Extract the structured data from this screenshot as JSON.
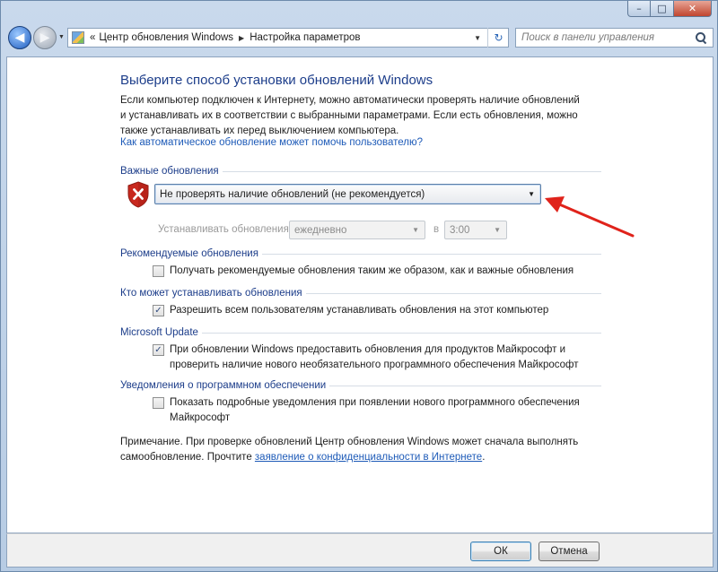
{
  "window": {
    "controls": {
      "minimize": "–",
      "maximize": "□",
      "close": "✕"
    }
  },
  "navbar": {
    "back_glyph": "◀",
    "forward_glyph": "▶",
    "breadcrumb": [
      "Центр обновления Windows",
      "Настройка параметров"
    ],
    "breadcrumb_prefix": "«",
    "search_placeholder": "Поиск в панели управления"
  },
  "page": {
    "title": "Выберите способ установки обновлений Windows",
    "intro": "Если компьютер подключен к Интернету, можно автоматически проверять наличие обновлений и устанавливать их в соответствии с выбранными параметрами. Если есть обновления, можно также устанавливать их перед выключением компьютера.",
    "help_link": "Как автоматическое обновление может помочь пользователю?"
  },
  "important": {
    "header": "Важные обновления",
    "selected": "Не проверять наличие обновлений (не рекомендуется)",
    "install_label": "Устанавливать обновления:",
    "day_value": "ежедневно",
    "at_label": "в",
    "time_value": "3:00"
  },
  "recommended": {
    "header": "Рекомендуемые обновления",
    "checkbox_label": "Получать рекомендуемые обновления таким же образом, как и важные обновления",
    "checked": false
  },
  "who": {
    "header": "Кто может устанавливать обновления",
    "checkbox_label": "Разрешить всем пользователям устанавливать обновления на этот компьютер",
    "checked": true
  },
  "microsoft_update": {
    "header": "Microsoft Update",
    "checkbox_label": "При обновлении Windows предоставить обновления для продуктов Майкрософт и проверить наличие нового необязательного программного обеспечения Майкрософт",
    "checked": true
  },
  "notifications": {
    "header": "Уведомления о программном обеспечении",
    "checkbox_label": "Показать подробные уведомления при появлении нового программного обеспечения Майкрософт",
    "checked": false
  },
  "note": {
    "text": "Примечание. При проверке обновлений Центр обновления Windows может сначала выполнять самообновление. Прочтите ",
    "link": "заявление о конфиденциальности в Интернете",
    "tail": "."
  },
  "buttons": {
    "ok": "ОК",
    "cancel": "Отмена"
  },
  "colors": {
    "heading": "#1c3d8a",
    "link": "#1e5bb8",
    "arrow": "#e0231b",
    "shield": "#c8281e"
  },
  "icons": {
    "shield": "shield-x-icon",
    "control_panel": "control-panel-icon",
    "search": "search-icon",
    "refresh": "refresh-icon"
  }
}
